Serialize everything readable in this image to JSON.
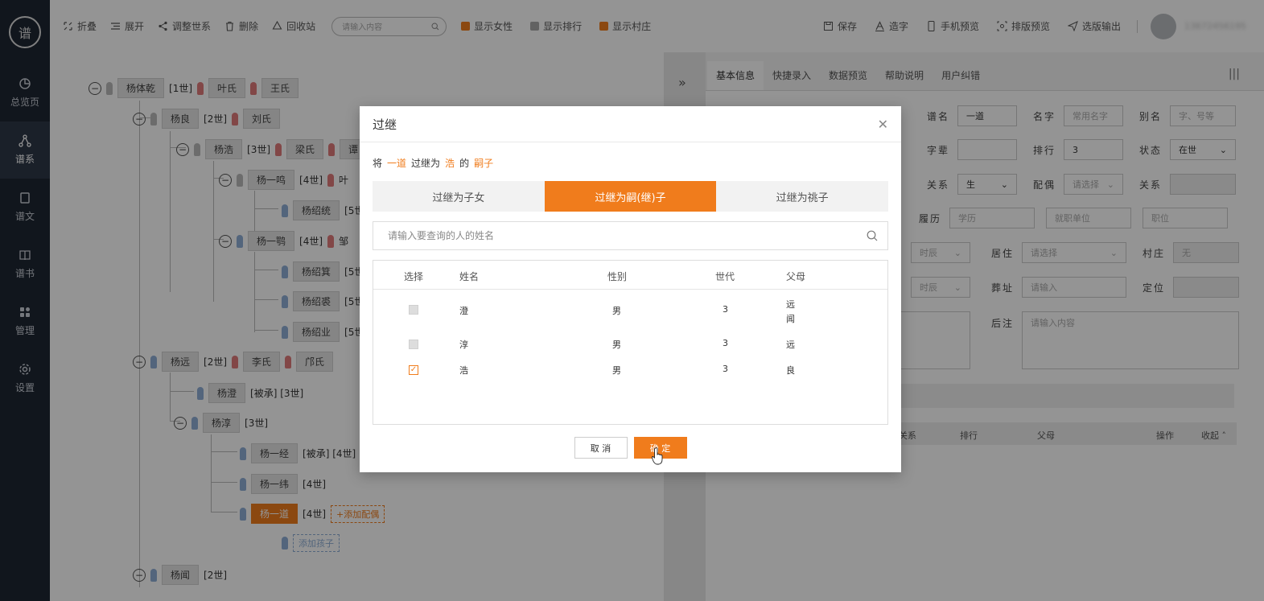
{
  "sidebar": {
    "logo_text": "谱",
    "items": [
      {
        "label": "总览页",
        "icon": "pie-chart-icon"
      },
      {
        "label": "谱系",
        "icon": "family-tree-icon",
        "active": true
      },
      {
        "label": "谱文",
        "icon": "document-icon"
      },
      {
        "label": "谱书",
        "icon": "book-icon"
      },
      {
        "label": "管理",
        "icon": "grid-icon"
      },
      {
        "label": "设置",
        "icon": "gear-icon"
      }
    ]
  },
  "toolbar": {
    "collapse": "折叠",
    "expand": "展开",
    "adjust": "调整世系",
    "delete": "删除",
    "recycle": "回收站",
    "search_placeholder": "请输入内容",
    "show_female": "显示女性",
    "show_rank": "显示排行",
    "show_village": "显示村庄",
    "save": "保存",
    "make_char": "造字",
    "mobile_preview": "手机预览",
    "layout_preview": "排版预览",
    "export": "选版输出",
    "user_id": "13672456195"
  },
  "tree": {
    "n1": {
      "name": "杨体乾",
      "gen": "[1世]",
      "sp1": "叶氏",
      "sp2": "王氏"
    },
    "n2": {
      "name": "杨良",
      "gen": "[2世]",
      "sp1": "刘氏"
    },
    "n3": {
      "name": "杨浩",
      "gen": "[3世]",
      "sp1": "梁氏",
      "sp2": "谭"
    },
    "n4": {
      "name": "杨一鸣",
      "gen": "[4世]",
      "sp1": "叶"
    },
    "n5": {
      "name": "杨绍统",
      "gen": "[5世"
    },
    "n6": {
      "name": "杨一鹗",
      "gen": "[4世]",
      "sp1": "邹"
    },
    "n7": {
      "name": "杨绍箕",
      "gen": "[5世"
    },
    "n8": {
      "name": "杨绍裘",
      "gen": "[5世"
    },
    "n9": {
      "name": "杨绍业",
      "gen": "[5世"
    },
    "n10": {
      "name": "杨远",
      "gen": "[2世]",
      "sp1": "李氏",
      "sp2": "邝氏"
    },
    "n11": {
      "name": "杨澄",
      "gen": "[被承] [3世]"
    },
    "n12": {
      "name": "杨淳",
      "gen": "[3世]"
    },
    "n13": {
      "name": "杨一经",
      "gen": "[被承] [4世]"
    },
    "n14": {
      "name": "杨一纬",
      "gen": "[4世]"
    },
    "n15": {
      "name": "杨一道",
      "gen": "[4世]",
      "add_spouse": "+添加配偶"
    },
    "add_child": "添加孩子",
    "n16": {
      "name": "杨闻",
      "gen": "[2世]"
    }
  },
  "right_panel": {
    "tabs": [
      "基本信息",
      "快捷录入",
      "数据预览",
      "帮助说明",
      "用户纠错"
    ],
    "fields": {
      "pu_name_label": "谱名",
      "pu_name_value": "一道",
      "ming_label": "名字",
      "ming_ph": "常用名字",
      "bieming_label": "别名",
      "bieming_ph": "字、号等",
      "zibei_label": "字辈",
      "rank_label": "排行",
      "rank_value": "3",
      "status_label": "状态",
      "status_value": "在世",
      "relation_label": "关系",
      "relation_value": "生",
      "spouse_label": "配偶",
      "spouse_ph": "请选择",
      "relation2_label": "关系",
      "resume_label": "履历",
      "edu_ph": "学历",
      "work_ph": "就职单位",
      "job_ph": "职位",
      "time_ph": "时辰",
      "reside_label": "居住",
      "reside_ph": "请选择",
      "village_label": "村庄",
      "village_value": "无",
      "time2_ph": "时辰",
      "burial_label": "葬址",
      "burial_ph": "请输入",
      "locate_label": "定位",
      "note_label": "后注",
      "note_ph": "请输入内容"
    },
    "table_head": {
      "relation": "关系",
      "rank": "排行",
      "parent": "父母",
      "op": "操作",
      "collapse": "收起"
    }
  },
  "modal": {
    "title": "过继",
    "desc": {
      "pre": "将",
      "who": "一道",
      "mid": "过继为",
      "target": "浩",
      "of": "的",
      "role": "嗣子"
    },
    "tabs": [
      "过继为子女",
      "过继为嗣(继)子",
      "过继为祧子"
    ],
    "active_tab": 1,
    "search_placeholder": "请输入要查询的人的姓名",
    "columns": {
      "select": "选择",
      "name": "姓名",
      "gender": "性别",
      "gen": "世代",
      "parents": "父母"
    },
    "rows": [
      {
        "name": "澄",
        "gender": "男",
        "gen": "3",
        "parents1": "远",
        "parents2": "闻",
        "checked": false
      },
      {
        "name": "淳",
        "gender": "男",
        "gen": "3",
        "parents1": "远",
        "parents2": "",
        "checked": false
      },
      {
        "name": "浩",
        "gender": "男",
        "gen": "3",
        "parents1": "良",
        "parents2": "",
        "checked": true
      }
    ],
    "cancel": "取 消",
    "ok": "确 定"
  },
  "colors": {
    "accent": "#f07c1c",
    "sidebar": "#1e2633"
  }
}
